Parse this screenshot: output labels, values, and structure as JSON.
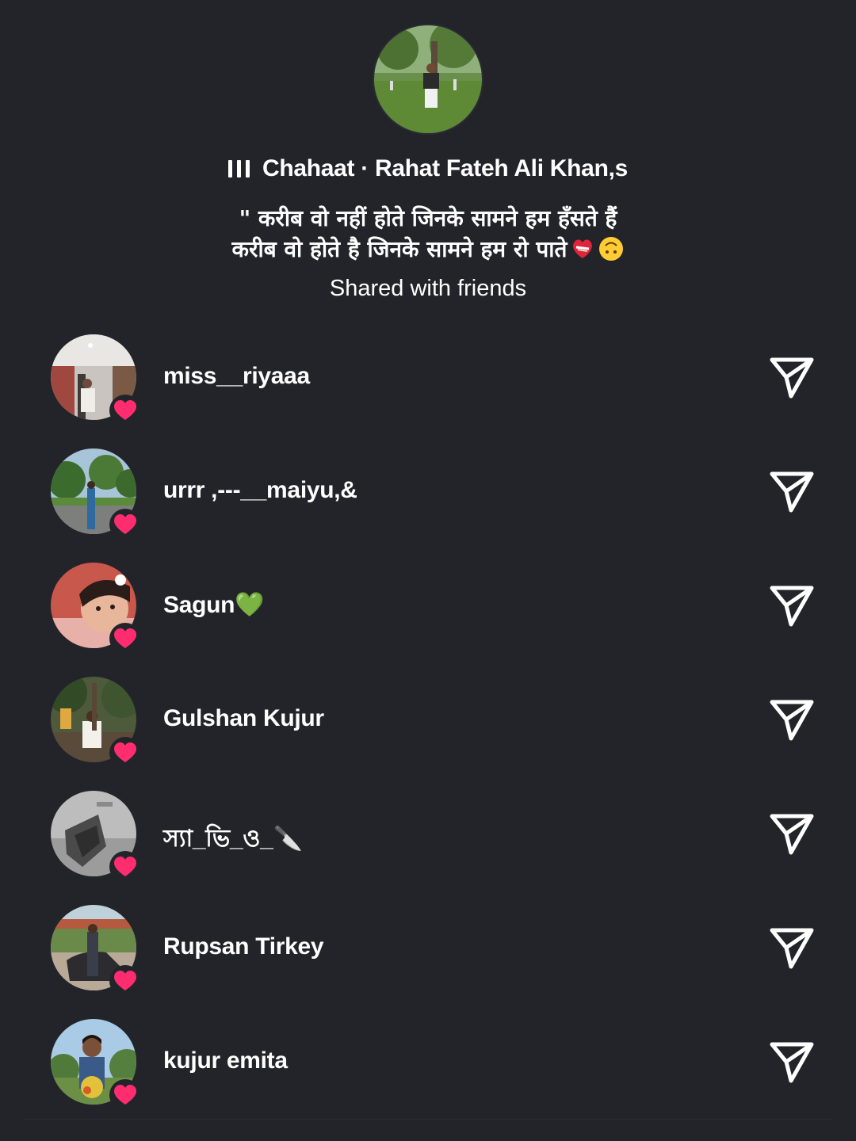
{
  "story": {
    "song": "Chahaat · Rahat Fateh Ali Khan,s",
    "caption_line1": "\" करीब वो नहीं होते जिनके सामने हम हँसते हैं",
    "caption_line2": "करीब वो होते है जिनके सामने हम रो पाते",
    "shared_label": "Shared with friends"
  },
  "friends": [
    {
      "name": "miss__riyaaa",
      "liked": true
    },
    {
      "name": "urrr ,---__maiyu,&",
      "liked": true
    },
    {
      "name": "Sagun💚",
      "liked": true
    },
    {
      "name": "Gulshan Kujur",
      "liked": true
    },
    {
      "name": "স্যা_ভি_ও_🔪",
      "liked": true
    },
    {
      "name": "Rupsan Tirkey",
      "liked": true
    },
    {
      "name": "kujur emita",
      "liked": true
    }
  ],
  "colors": {
    "background": "#232429",
    "text": "#ffffff",
    "heart": "#ff2d6f"
  },
  "icons": {
    "song": "music-bars-icon",
    "send": "send-icon",
    "like": "heart-icon"
  }
}
